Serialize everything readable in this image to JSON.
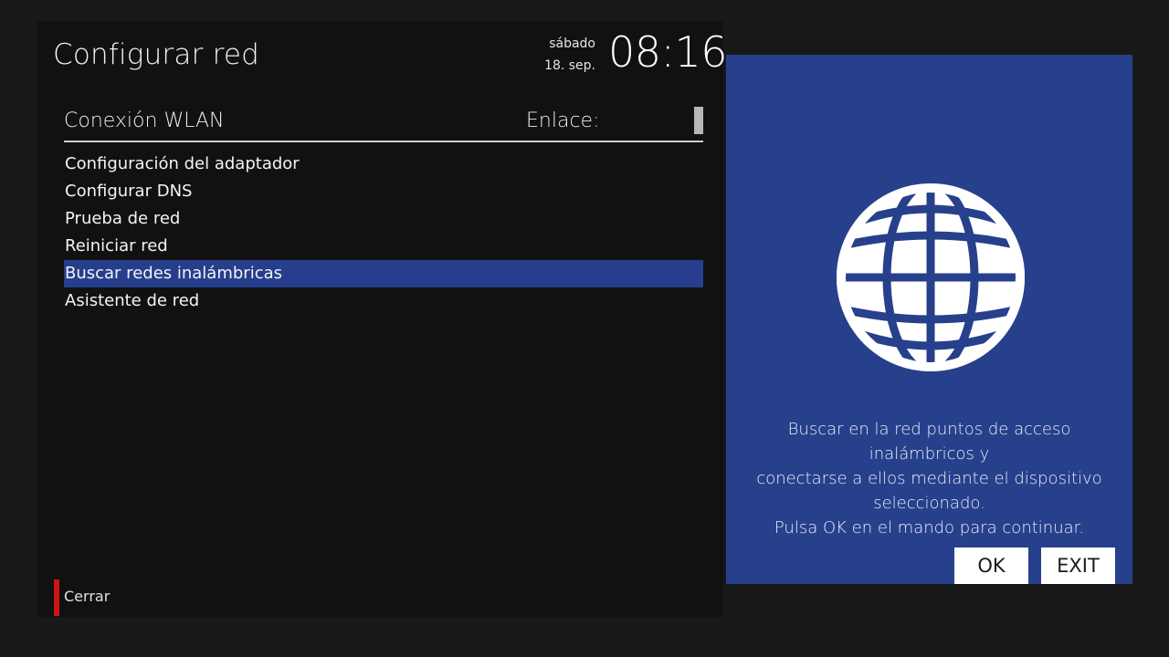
{
  "header": {
    "title": "Configurar red",
    "day": "sábado",
    "date": "18. sep.",
    "time": "08:16"
  },
  "connection": {
    "label": "Conexión WLAN",
    "link_label": "Enlace:"
  },
  "menu": {
    "items": [
      {
        "label": "Configuración del adaptador",
        "selected": false
      },
      {
        "label": "Configurar DNS",
        "selected": false
      },
      {
        "label": "Prueba de red",
        "selected": false
      },
      {
        "label": "Reiniciar red",
        "selected": false
      },
      {
        "label": "Buscar redes inalámbricas",
        "selected": true
      },
      {
        "label": "Asistente de red",
        "selected": false
      }
    ]
  },
  "footer": {
    "close_label": "Cerrar",
    "close_key_color": "#cc1515"
  },
  "info": {
    "icon": "globe-icon",
    "line1": "Buscar en la red puntos de acceso inalámbricos y",
    "line2": "conectarse a ellos mediante el dispositivo",
    "line3": "seleccionado.",
    "line4": "Pulsa OK en el mando para continuar.",
    "ok_label": "OK",
    "exit_label": "EXIT"
  },
  "colors": {
    "accent": "#27408b",
    "selection": "#263e8c",
    "background": "#111111"
  }
}
